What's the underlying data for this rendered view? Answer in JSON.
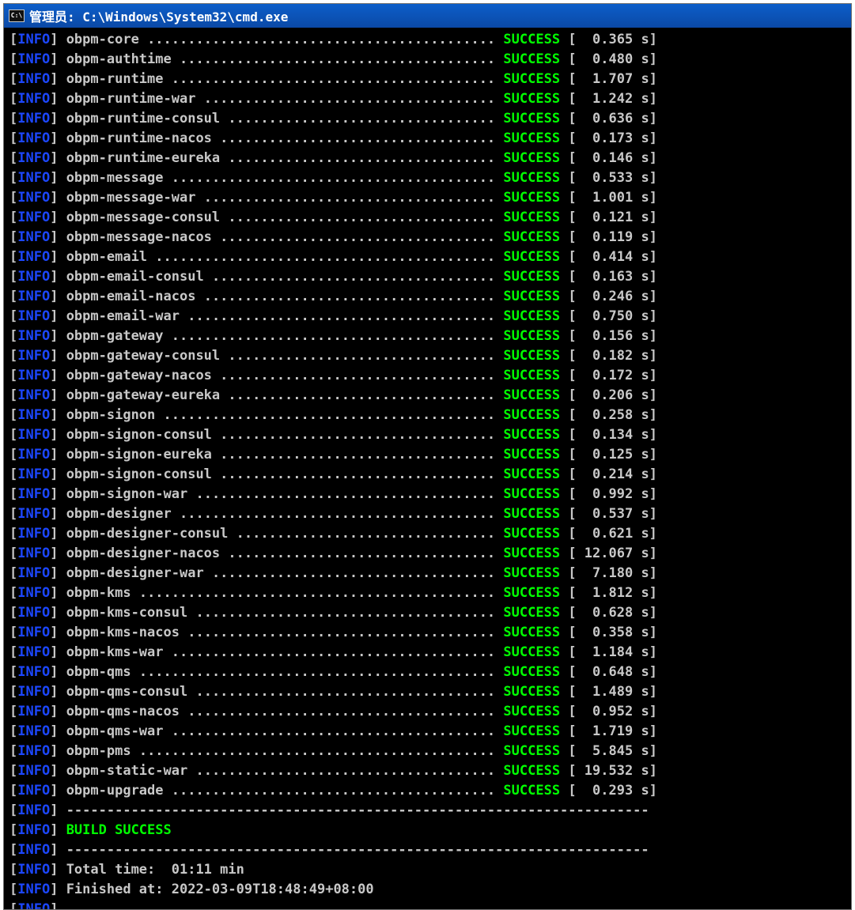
{
  "window": {
    "title": "管理员: C:\\Windows\\System32\\cmd.exe",
    "icon_text": "C:\\",
    "icon": "console-icon"
  },
  "colors": {
    "info_tag": "#1c47ff",
    "success": "#00ff00",
    "text": "#c8c8c8",
    "background": "#000000",
    "titlebar": "#0b5ac9"
  },
  "console": {
    "level_tag": "INFO",
    "modules": [
      {
        "name": "obpm-core",
        "dots": "...........................................",
        "status": "SUCCESS",
        "time": " 0.365"
      },
      {
        "name": "obpm-authtime",
        "dots": ".......................................",
        "status": "SUCCESS",
        "time": " 0.480"
      },
      {
        "name": "obpm-runtime",
        "dots": "........................................",
        "status": "SUCCESS",
        "time": " 1.707"
      },
      {
        "name": "obpm-runtime-war",
        "dots": "....................................",
        "status": "SUCCESS",
        "time": " 1.242"
      },
      {
        "name": "obpm-runtime-consul",
        "dots": ".................................",
        "status": "SUCCESS",
        "time": " 0.636"
      },
      {
        "name": "obpm-runtime-nacos",
        "dots": "..................................",
        "status": "SUCCESS",
        "time": " 0.173"
      },
      {
        "name": "obpm-runtime-eureka",
        "dots": ".................................",
        "status": "SUCCESS",
        "time": " 0.146"
      },
      {
        "name": "obpm-message",
        "dots": "........................................",
        "status": "SUCCESS",
        "time": " 0.533"
      },
      {
        "name": "obpm-message-war",
        "dots": "....................................",
        "status": "SUCCESS",
        "time": " 1.001"
      },
      {
        "name": "obpm-message-consul",
        "dots": ".................................",
        "status": "SUCCESS",
        "time": " 0.121"
      },
      {
        "name": "obpm-message-nacos",
        "dots": "..................................",
        "status": "SUCCESS",
        "time": " 0.119"
      },
      {
        "name": "obpm-email",
        "dots": "..........................................",
        "status": "SUCCESS",
        "time": " 0.414"
      },
      {
        "name": "obpm-email-consul",
        "dots": "...................................",
        "status": "SUCCESS",
        "time": " 0.163"
      },
      {
        "name": "obpm-email-nacos",
        "dots": "....................................",
        "status": "SUCCESS",
        "time": " 0.246"
      },
      {
        "name": "obpm-email-war",
        "dots": "......................................",
        "status": "SUCCESS",
        "time": " 0.750"
      },
      {
        "name": "obpm-gateway",
        "dots": "........................................",
        "status": "SUCCESS",
        "time": " 0.156"
      },
      {
        "name": "obpm-gateway-consul",
        "dots": ".................................",
        "status": "SUCCESS",
        "time": " 0.182"
      },
      {
        "name": "obpm-gateway-nacos",
        "dots": "..................................",
        "status": "SUCCESS",
        "time": " 0.172"
      },
      {
        "name": "obpm-gateway-eureka",
        "dots": ".................................",
        "status": "SUCCESS",
        "time": " 0.206"
      },
      {
        "name": "obpm-signon",
        "dots": ".........................................",
        "status": "SUCCESS",
        "time": " 0.258"
      },
      {
        "name": "obpm-signon-consul",
        "dots": "..................................",
        "status": "SUCCESS",
        "time": " 0.134"
      },
      {
        "name": "obpm-signon-eureka",
        "dots": "..................................",
        "status": "SUCCESS",
        "time": " 0.125"
      },
      {
        "name": "obpm-signon-consul",
        "dots": "..................................",
        "status": "SUCCESS",
        "time": " 0.214"
      },
      {
        "name": "obpm-signon-war",
        "dots": ".....................................",
        "status": "SUCCESS",
        "time": " 0.992"
      },
      {
        "name": "obpm-designer",
        "dots": ".......................................",
        "status": "SUCCESS",
        "time": " 0.537"
      },
      {
        "name": "obpm-designer-consul",
        "dots": "................................",
        "status": "SUCCESS",
        "time": " 0.621"
      },
      {
        "name": "obpm-designer-nacos",
        "dots": ".................................",
        "status": "SUCCESS",
        "time": "12.067"
      },
      {
        "name": "obpm-designer-war",
        "dots": "...................................",
        "status": "SUCCESS",
        "time": " 7.180"
      },
      {
        "name": "obpm-kms",
        "dots": "............................................",
        "status": "SUCCESS",
        "time": " 1.812"
      },
      {
        "name": "obpm-kms-consul",
        "dots": ".....................................",
        "status": "SUCCESS",
        "time": " 0.628"
      },
      {
        "name": "obpm-kms-nacos",
        "dots": "......................................",
        "status": "SUCCESS",
        "time": " 0.358"
      },
      {
        "name": "obpm-kms-war",
        "dots": "........................................",
        "status": "SUCCESS",
        "time": " 1.184"
      },
      {
        "name": "obpm-qms",
        "dots": "............................................",
        "status": "SUCCESS",
        "time": " 0.648"
      },
      {
        "name": "obpm-qms-consul",
        "dots": ".....................................",
        "status": "SUCCESS",
        "time": " 1.489"
      },
      {
        "name": "obpm-qms-nacos",
        "dots": "......................................",
        "status": "SUCCESS",
        "time": " 0.952"
      },
      {
        "name": "obpm-qms-war",
        "dots": "........................................",
        "status": "SUCCESS",
        "time": " 1.719"
      },
      {
        "name": "obpm-pms",
        "dots": "............................................",
        "status": "SUCCESS",
        "time": " 5.845"
      },
      {
        "name": "obpm-static-war",
        "dots": ".....................................",
        "status": "SUCCESS",
        "time": "19.532"
      },
      {
        "name": "obpm-upgrade",
        "dots": "........................................",
        "status": "SUCCESS",
        "time": " 0.293"
      }
    ],
    "separator": "------------------------------------------------------------------------",
    "build_result": "BUILD SUCCESS",
    "total_time": "Total time:  01:11 min",
    "finished_at": "Finished at: 2022-03-09T18:48:49+08:00"
  }
}
